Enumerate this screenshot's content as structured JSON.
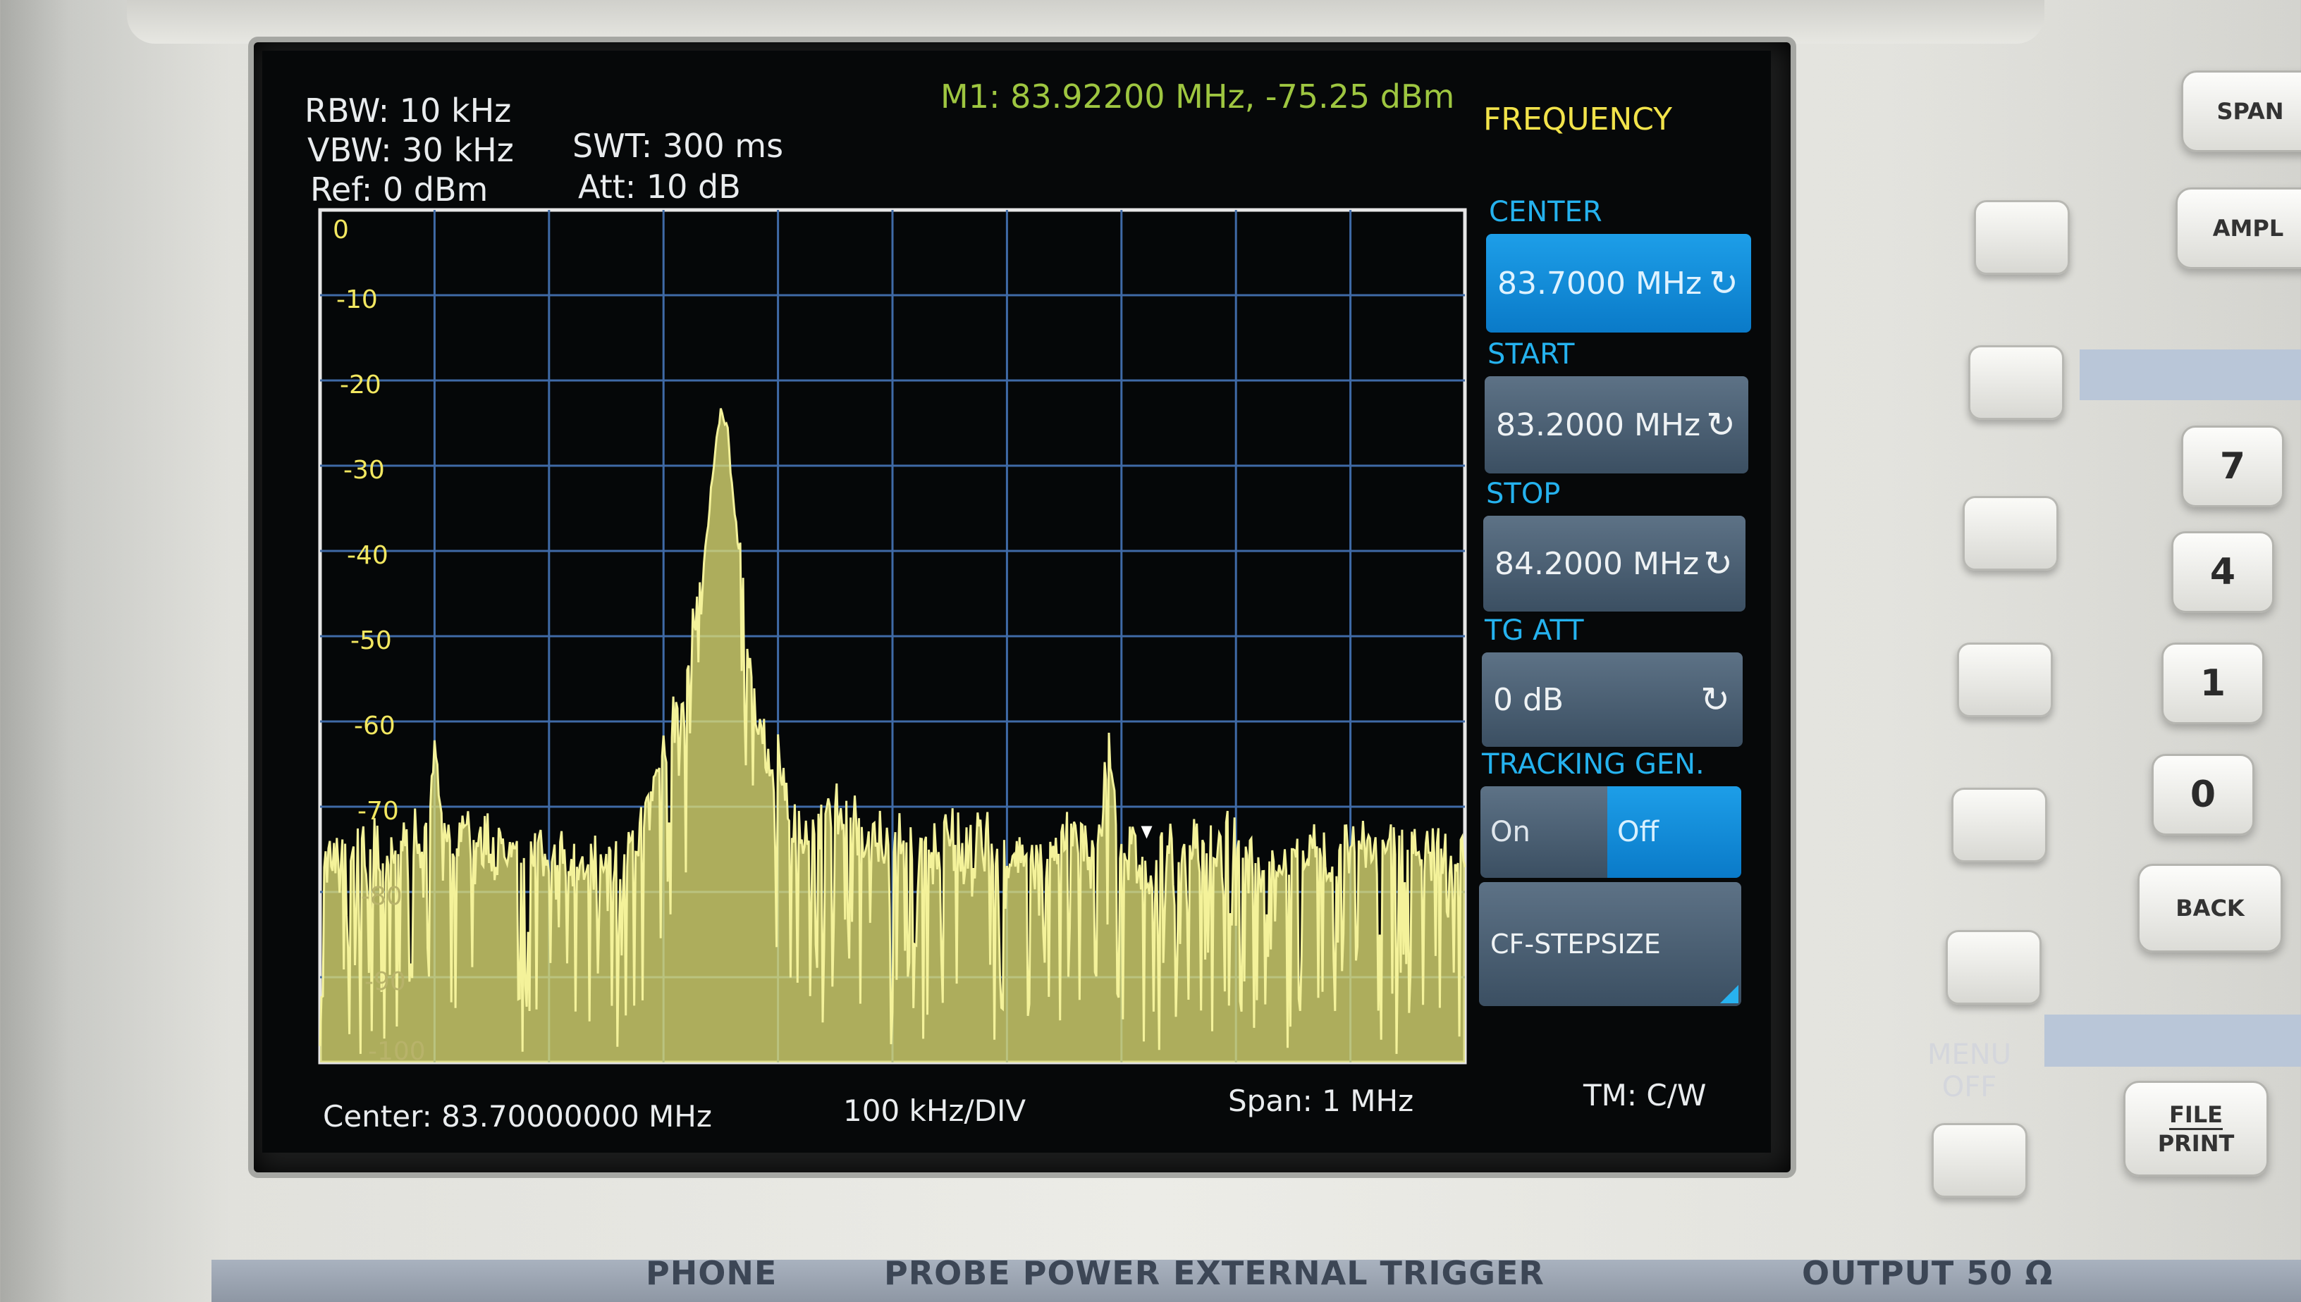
{
  "header": {
    "rbw": "RBW: 10 kHz",
    "vbw": "VBW: 30 kHz",
    "ref": "Ref: 0 dBm",
    "swt": "SWT: 300 ms",
    "att": "Att: 10 dB",
    "marker": "M1: 83.92200 MHz, -75.25 dBm"
  },
  "menu_title": "FREQUENCY",
  "softkeys": {
    "center_label": "CENTER",
    "center_value": "83.7000 MHz",
    "start_label": "START",
    "start_value": "83.2000 MHz",
    "stop_label": "STOP",
    "stop_value": "84.2000 MHz",
    "tgatt_label": "TG ATT",
    "tgatt_value": "0 dB",
    "tracking_label": "TRACKING GEN.",
    "on": "On",
    "off": "Off",
    "stepsize": "CF-STEPSIZE"
  },
  "footer": {
    "center": "Center: 83.70000000 MHz",
    "div": "100 kHz/DIV",
    "span": "Span: 1 MHz",
    "tm": "TM: C/W"
  },
  "hardware": {
    "span": "SPAN",
    "ampl": "AMPL",
    "keys": [
      "7",
      "4",
      "1",
      "0"
    ],
    "back": "BACK",
    "file_print_1": "FILE",
    "file_print_2": "PRINT",
    "menu_off_1": "MENU",
    "menu_off_2": "OFF",
    "panel_labels": [
      "PHONE",
      "PROBE POWER",
      "EXTERNAL TRIGGER",
      "OUTPUT 50 Ω"
    ]
  },
  "colors": {
    "trace": "#f4f29a",
    "grid": "#3f6aa6",
    "softkey_selected": "#1d9ee8",
    "menu_title": "#f2e34a"
  },
  "chart_data": {
    "type": "line",
    "xlabel": "",
    "ylabel": "",
    "xlim": [
      83.2,
      84.2
    ],
    "ylim": [
      -100,
      0
    ],
    "y_ticks": [
      0,
      -10,
      -20,
      -30,
      -40,
      -50,
      -60,
      -70,
      -80,
      -90,
      -100
    ],
    "grid": true,
    "series": [
      {
        "x": [
          83.2,
          83.25,
          83.29,
          83.3,
          83.31,
          83.35,
          83.4,
          83.45,
          83.48,
          83.5,
          83.52,
          83.535,
          83.545,
          83.55,
          83.555,
          83.565,
          83.58,
          83.6,
          83.62,
          83.65,
          83.7,
          83.75,
          83.8,
          83.85,
          83.88,
          83.89,
          83.9,
          83.92,
          83.95,
          84.0,
          84.05,
          84.1,
          84.15,
          84.2
        ],
        "y": [
          -75,
          -74,
          -72,
          -63,
          -72,
          -73,
          -74,
          -75,
          -72,
          -62,
          -55,
          -40,
          -28,
          -22,
          -24,
          -38,
          -57,
          -64,
          -72,
          -70,
          -73,
          -72,
          -74,
          -72,
          -73,
          -61,
          -73,
          -75,
          -74,
          -73,
          -75,
          -73,
          -74,
          -74
        ]
      }
    ]
  }
}
